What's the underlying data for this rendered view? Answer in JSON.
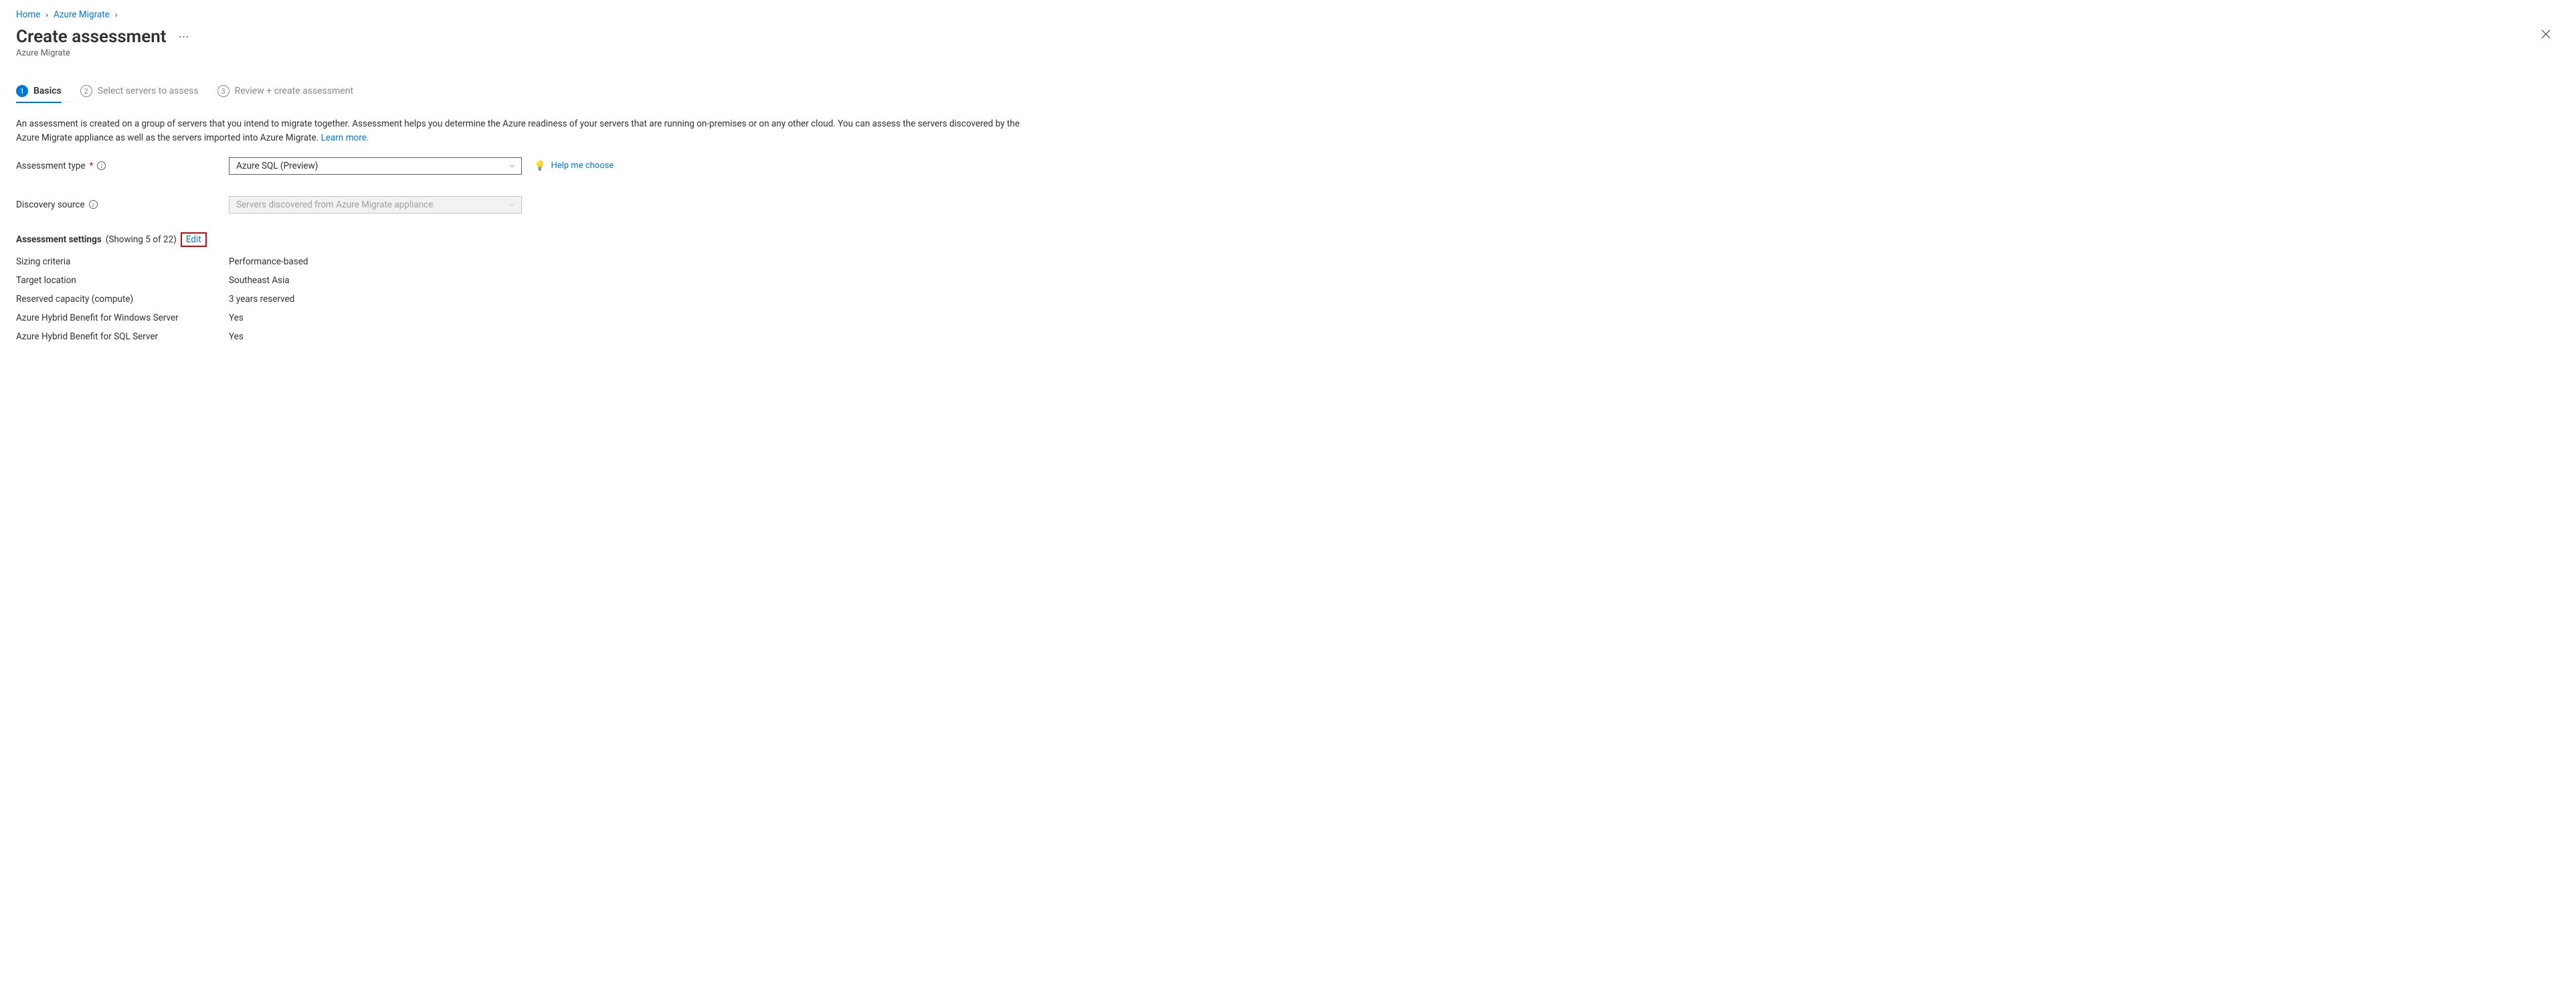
{
  "breadcrumb": {
    "home": "Home",
    "azure_migrate": "Azure Migrate"
  },
  "header": {
    "title": "Create assessment",
    "subtitle": "Azure Migrate"
  },
  "tabs": [
    {
      "num": "1",
      "label": "Basics"
    },
    {
      "num": "2",
      "label": "Select servers to assess"
    },
    {
      "num": "3",
      "label": "Review + create assessment"
    }
  ],
  "description": {
    "text": "An assessment is created on a group of servers that you intend to migrate together. Assessment helps you determine the Azure readiness of your servers that are running on-premises or on any other cloud. You can assess the servers discovered by the Azure Migrate appliance as well as the servers imported into Azure Migrate. ",
    "learn_more": "Learn more."
  },
  "form": {
    "assessment_type": {
      "label": "Assessment type",
      "value": "Azure SQL (Preview)",
      "help": "Help me choose"
    },
    "discovery_source": {
      "label": "Discovery source",
      "value": "Servers discovered from Azure Migrate appliance"
    }
  },
  "settings": {
    "title": "Assessment settings",
    "showing": "(Showing 5 of 22)",
    "edit": "Edit",
    "rows": [
      {
        "k": "Sizing criteria",
        "v": "Performance-based"
      },
      {
        "k": "Target location",
        "v": "Southeast Asia"
      },
      {
        "k": "Reserved capacity (compute)",
        "v": "3 years reserved"
      },
      {
        "k": "Azure Hybrid Benefit for Windows Server",
        "v": "Yes"
      },
      {
        "k": "Azure Hybrid Benefit for SQL Server",
        "v": "Yes"
      }
    ]
  }
}
